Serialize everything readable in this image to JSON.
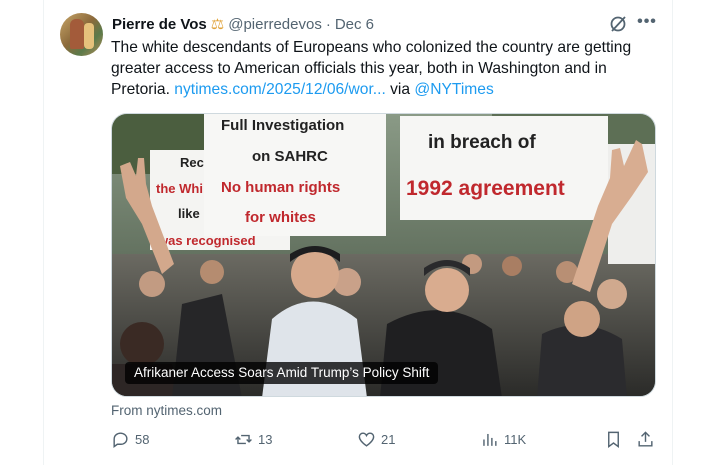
{
  "tweet": {
    "author_name": "Pierre de Vos",
    "badge_icon": "scales-icon",
    "handle": "@pierredevos",
    "separator": "·",
    "date": "Dec 6",
    "text_before_link": "The white descendants of Europeans who colonized the country are getting greater access to American officials this year, both in Washington and in Pretoria. ",
    "link_text": "nytimes.com/2025/12/06/wor...",
    "via_text": " via ",
    "mention": "@NYTimes"
  },
  "card": {
    "headline": "Afrikaner Access Soars Amid Trump’s Policy Shift",
    "source": "From nytimes.com",
    "signs": {
      "sign1_line1": "Full Investigation",
      "sign1_line2": "on SAHRC",
      "sign1_line3": "No human rights",
      "sign1_line4": "for whites",
      "sign2_line1": "in breach of",
      "sign2_line2": "1992 agreement",
      "sign3_line1": "Reco",
      "sign3_line2": "the Whi",
      "sign3_line3": "like",
      "sign3_line4": "was recognised"
    }
  },
  "actions": {
    "replies": "58",
    "reposts": "13",
    "likes": "21",
    "views": "11K"
  },
  "colors": {
    "link": "#1d9bf0",
    "muted": "#536471",
    "sign_red": "#c0282d"
  }
}
